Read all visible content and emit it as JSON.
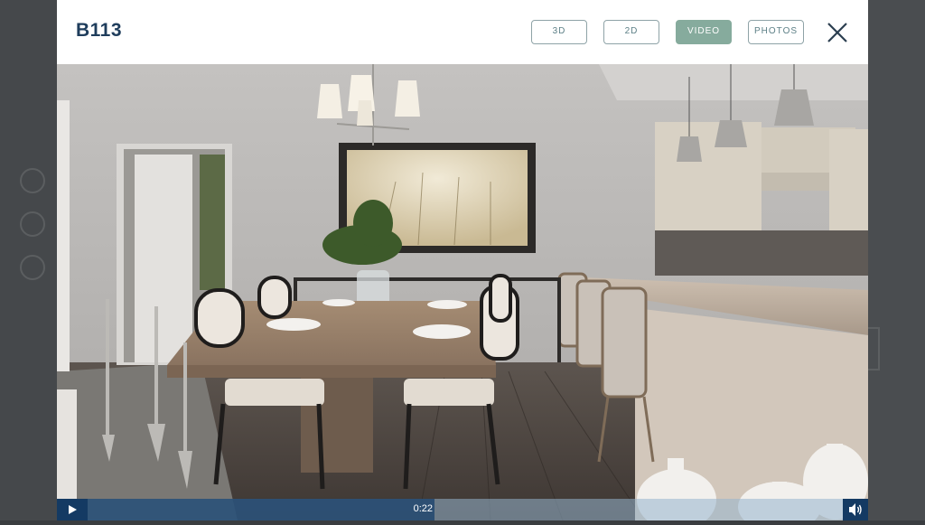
{
  "modal": {
    "title": "B113",
    "tabs": [
      {
        "label": "3D",
        "active": false
      },
      {
        "label": "2D",
        "active": false
      },
      {
        "label": "VIDEO",
        "active": true
      },
      {
        "label": "PHOTOS",
        "active": false
      }
    ],
    "close_icon": "close-icon"
  },
  "player": {
    "current_time": "0:22",
    "progress_fraction": 0.465,
    "play_icon": "play-icon",
    "volume_icon": "volume-icon"
  },
  "colors": {
    "title": "#1f3d5c",
    "tab_border": "#8fa3a7",
    "tab_active": "#86ab9d",
    "player_dark": "#143a63"
  }
}
